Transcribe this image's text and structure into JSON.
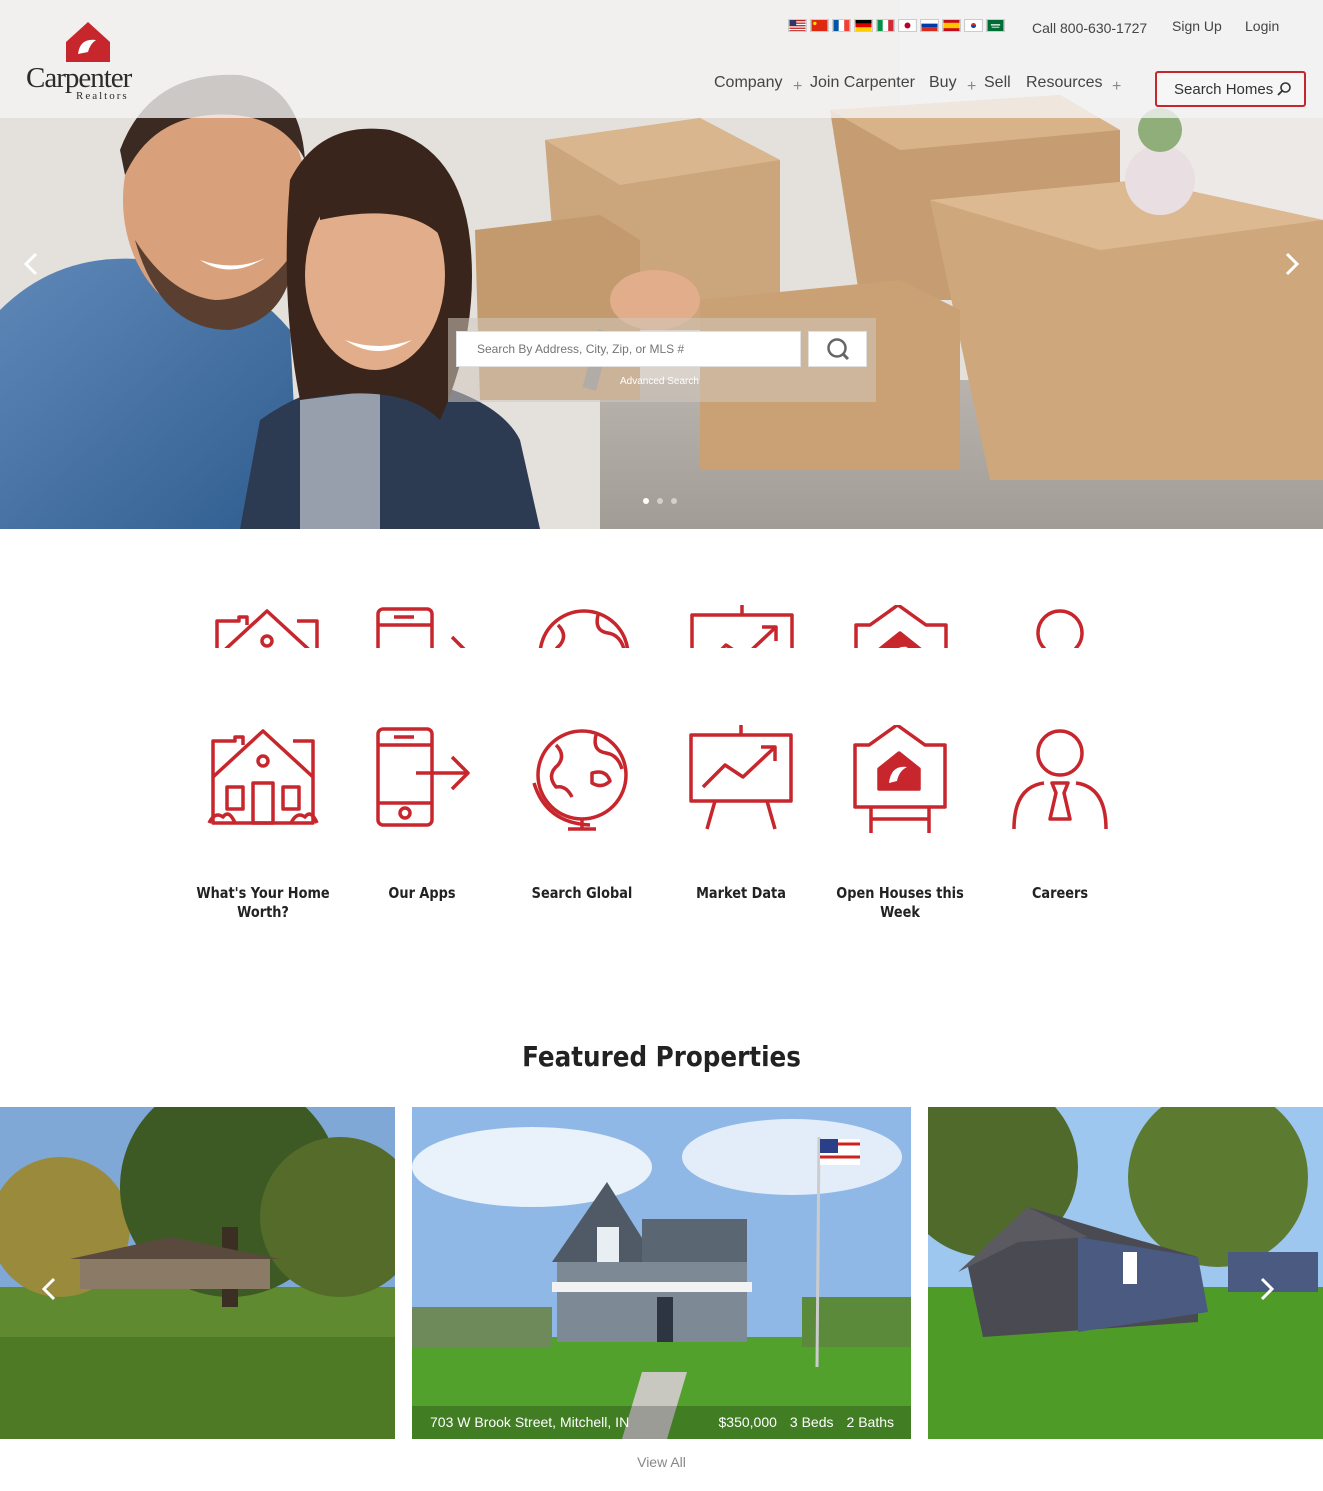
{
  "brand": {
    "name": "Carpenter",
    "sub": "Realtors",
    "accent": "#c7262c"
  },
  "topbar": {
    "phone": "Call 800-630-1727",
    "signup": "Sign Up",
    "login": "Login",
    "flags": [
      "us-flag",
      "cn-flag",
      "fr-flag",
      "de-flag",
      "it-flag",
      "jp-flag",
      "ru-flag",
      "es-flag",
      "kr-flag",
      "sa-flag"
    ]
  },
  "nav": {
    "company": "Company",
    "join": "Join Carpenter",
    "buy": "Buy",
    "sell": "Sell",
    "resources": "Resources",
    "search_homes": "Search Homes"
  },
  "hero": {
    "search_placeholder": "Search By Address, City, Zip, or MLS #",
    "advanced": "Advanced Search"
  },
  "quick_links": [
    {
      "label": "What's Your Home Worth?",
      "icon": "house-icon"
    },
    {
      "label": "Our Apps",
      "icon": "phone-app-icon"
    },
    {
      "label": "Search Global",
      "icon": "globe-icon"
    },
    {
      "label": "Market Data",
      "icon": "chart-easel-icon"
    },
    {
      "label": "Open Houses this Week",
      "icon": "open-house-sign-icon"
    },
    {
      "label": "Careers",
      "icon": "person-tie-icon"
    }
  ],
  "featured": {
    "title": "Featured Properties",
    "listing": {
      "address": "703 W Brook Street, Mitchell, IN",
      "price": "$350,000",
      "beds": "3 Beds",
      "baths": "2 Baths"
    },
    "view_all": "View All"
  }
}
